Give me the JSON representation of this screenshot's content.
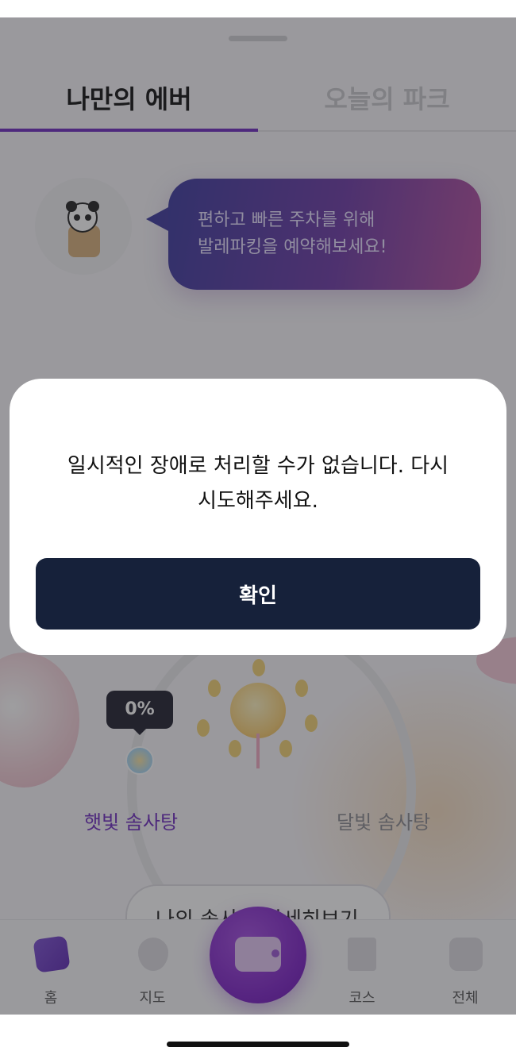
{
  "tabs": [
    {
      "label": "나만의 에버",
      "active": true
    },
    {
      "label": "오늘의 파크",
      "active": false
    }
  ],
  "bubble": {
    "text": "편하고 빠른 주차를 위해\n발레파킹을 예약해보세요!"
  },
  "candy": {
    "progress_label": "0%",
    "progress": 0,
    "left_label": "햇빛 솜사탕",
    "right_label": "달빛 솜사탕"
  },
  "pill": {
    "text": "나의 솜사탕 자세히보기"
  },
  "nav": {
    "items": [
      {
        "label": "홈",
        "icon": "home-icon"
      },
      {
        "label": "지도",
        "icon": "map-pin-icon"
      },
      {
        "label": "",
        "icon": "wallet-icon"
      },
      {
        "label": "코스",
        "icon": "bookmark-icon"
      },
      {
        "label": "전체",
        "icon": "more-icon"
      }
    ]
  },
  "modal": {
    "message": "일시적인 장애로 처리할 수가 없습니다. 다시\n시도해주세요.",
    "confirm_label": "확인"
  },
  "colors": {
    "accent": "#6d2bbf",
    "button": "#16213a",
    "fab": "#7a1fc4"
  }
}
